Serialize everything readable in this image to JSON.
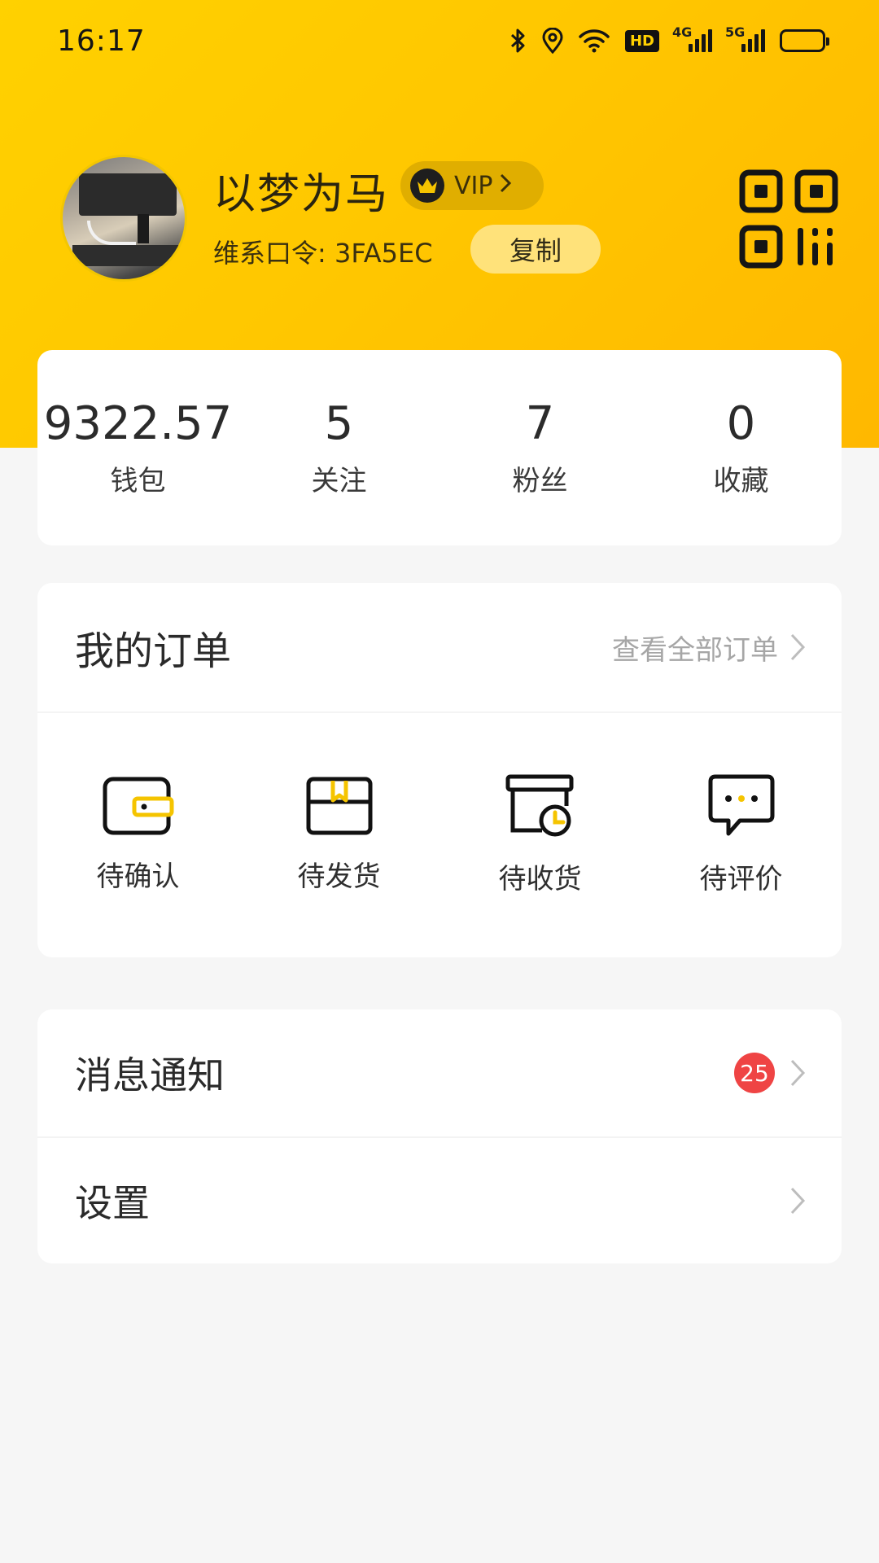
{
  "status_bar": {
    "time": "16:17",
    "hd_label": "HD",
    "net1_label": "4G",
    "net2_label": "5G"
  },
  "profile": {
    "username": "以梦为马",
    "vip_label": "VIP",
    "code_label": "维系口令: 3FA5EC",
    "copy_label": "复制"
  },
  "stats": [
    {
      "value": "9322.57",
      "label": "钱包"
    },
    {
      "value": "5",
      "label": "关注"
    },
    {
      "value": "7",
      "label": "粉丝"
    },
    {
      "value": "0",
      "label": "收藏"
    }
  ],
  "orders": {
    "title": "我的订单",
    "view_all": "查看全部订单",
    "items": [
      {
        "label": "待确认",
        "icon": "wallet-icon"
      },
      {
        "label": "待发货",
        "icon": "package-icon"
      },
      {
        "label": "待收货",
        "icon": "delivery-box-clock-icon"
      },
      {
        "label": "待评价",
        "icon": "chat-bubble-icon"
      }
    ]
  },
  "menu": {
    "messages": {
      "label": "消息通知",
      "badge": "25"
    },
    "settings": {
      "label": "设置"
    }
  },
  "colors": {
    "brand_yellow": "#ffd100",
    "accent_yellow": "#f5c400",
    "badge_red": "#ef4444"
  }
}
